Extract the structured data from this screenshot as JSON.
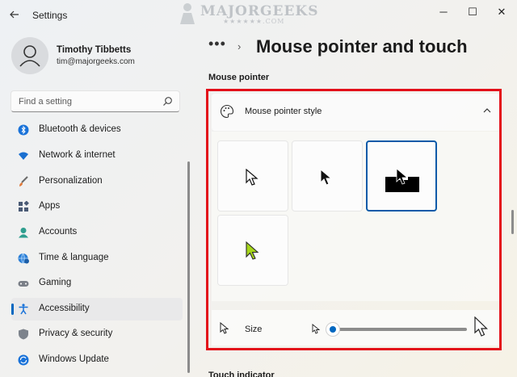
{
  "window": {
    "app_title": "Settings",
    "back_icon": "back-arrow-icon",
    "controls": {
      "minimize": "─",
      "maximize": "☐",
      "close": "✕"
    }
  },
  "watermark": {
    "text": "MAJORGEEKS",
    "sub": "★★★★★★.COM"
  },
  "profile": {
    "name": "Timothy Tibbetts",
    "email": "tim@majorgeeks.com"
  },
  "search": {
    "placeholder": "Find a setting"
  },
  "sidebar": {
    "items": [
      {
        "label": "Bluetooth & devices",
        "icon": "bluetooth-icon",
        "active": false
      },
      {
        "label": "Network & internet",
        "icon": "wifi-icon",
        "active": false
      },
      {
        "label": "Personalization",
        "icon": "brush-icon",
        "active": false
      },
      {
        "label": "Apps",
        "icon": "apps-icon",
        "active": false
      },
      {
        "label": "Accounts",
        "icon": "person-icon",
        "active": false
      },
      {
        "label": "Time & language",
        "icon": "globe-clock-icon",
        "active": false
      },
      {
        "label": "Gaming",
        "icon": "gamepad-icon",
        "active": false
      },
      {
        "label": "Accessibility",
        "icon": "accessibility-icon",
        "active": true
      },
      {
        "label": "Privacy & security",
        "icon": "shield-icon",
        "active": false
      },
      {
        "label": "Windows Update",
        "icon": "update-icon",
        "active": false
      }
    ]
  },
  "breadcrumb": {
    "overflow": "•••",
    "separator": "›",
    "current": "Mouse pointer and touch"
  },
  "section": {
    "label": "Mouse pointer"
  },
  "pointer_style": {
    "title": "Mouse pointer style",
    "options": [
      {
        "name": "White",
        "icon": "white-pointer-icon",
        "selected": false
      },
      {
        "name": "Black",
        "icon": "black-pointer-icon",
        "selected": false
      },
      {
        "name": "Inverted",
        "icon": "inverted-pointer-icon",
        "selected": true
      },
      {
        "name": "Custom",
        "icon": "custom-color-pointer-icon",
        "selected": false
      }
    ]
  },
  "size": {
    "label": "Size",
    "value": 1,
    "min": 1,
    "max": 15
  },
  "next_section": {
    "label": "Touch indicator"
  },
  "colors": {
    "accent": "#0067c0",
    "highlight": "#e3101a",
    "custom_pointer": "#a6d61a"
  }
}
